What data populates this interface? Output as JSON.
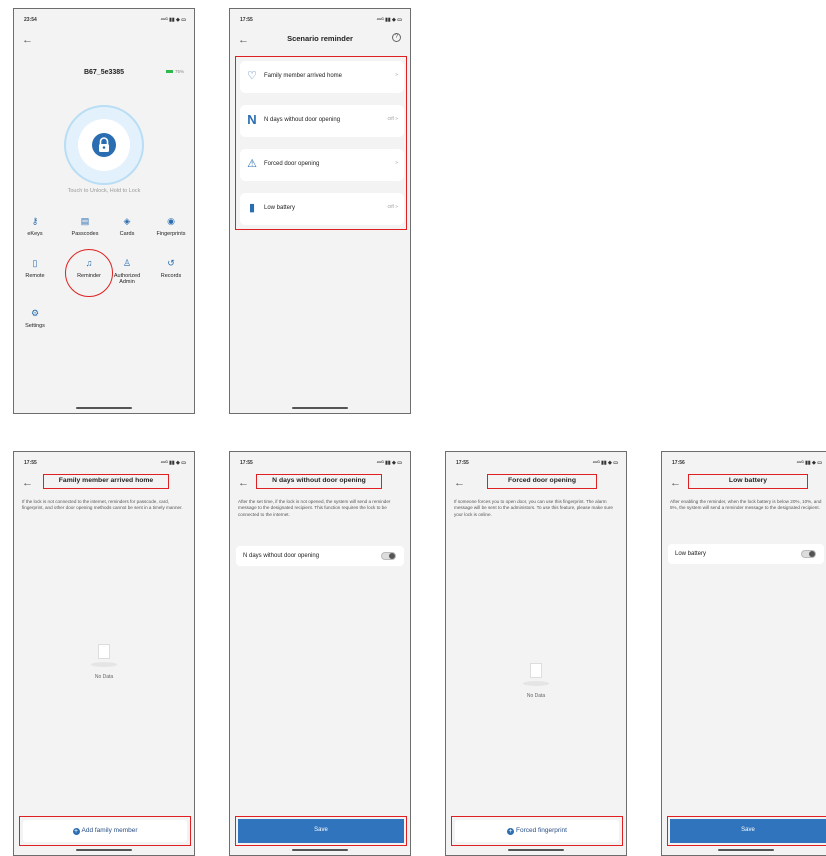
{
  "phone_lock": {
    "time": "23:54",
    "status_icons": "⁴⁶ᴳ ▮▮ ◆ ▭",
    "device_name": "B67_5e3385",
    "battery": "75%",
    "touch_hint": "Touch to Unlock, Hold to Lock",
    "menu": [
      {
        "label": "eKeys",
        "icon": "person-key-icon",
        "glyph": "⚷"
      },
      {
        "label": "Passcodes",
        "icon": "keypad-icon",
        "glyph": "▤"
      },
      {
        "label": "Cards",
        "icon": "card-icon",
        "glyph": "◈"
      },
      {
        "label": "Fingerprints",
        "icon": "fingerprint-icon",
        "glyph": "◉"
      },
      {
        "label": "Remote",
        "icon": "remote-icon",
        "glyph": "▯"
      },
      {
        "label": "Reminder",
        "icon": "bell-icon",
        "glyph": "♫"
      },
      {
        "label": "Authorized Admin",
        "icon": "admin-icon",
        "glyph": "♙"
      },
      {
        "label": "Records",
        "icon": "history-icon",
        "glyph": "↺"
      },
      {
        "label": "Settings",
        "icon": "gear-icon",
        "glyph": "⚙"
      }
    ],
    "colors": {
      "accent": "#2a6db0",
      "highlight": "#e02020"
    }
  },
  "phone_scenario": {
    "time": "17:55",
    "title": "Scenario reminder",
    "rows": [
      {
        "label": "Family member arrived home",
        "value": "",
        "icon": "heart-home-icon",
        "glyph": "♡"
      },
      {
        "label": "N days without door opening",
        "value": "Off",
        "icon": "n-letter-icon",
        "glyph": "N"
      },
      {
        "label": "Forced door opening",
        "value": "",
        "icon": "warning-icon",
        "glyph": "⚠"
      },
      {
        "label": "Low battery",
        "value": "Off",
        "icon": "battery-icon",
        "glyph": "▮"
      }
    ]
  },
  "phone_family": {
    "time": "17:55",
    "title": "Family member arrived home",
    "description": "If the lock is not connected to the internet, reminders for passcode, card, fingerprint, and other door opening methods cannot be sent in a timely manner.",
    "empty_text": "No Data",
    "button": "Add family member"
  },
  "phone_ndays": {
    "time": "17:55",
    "title": "N days without door opening",
    "description": "After the set time, if the lock is not opened, the system will send a reminder message to the designated recipient. This function requires the lock to be connected to the internet.",
    "toggle_label": "N days without door opening",
    "button": "Save"
  },
  "phone_forced": {
    "time": "17:55",
    "title": "Forced door opening",
    "description": "If someone forces you to open door, you can use this fingerprint. The alarm message will be sent to the administors. To use this feature, please make sure your lock is online.",
    "empty_text": "No Data",
    "button": "Forced fingerprint"
  },
  "phone_battery": {
    "time": "17:56",
    "title": "Low battery",
    "description": "After enabling the reminder, when the lock battery is below 20%, 10%, and 5%, the system will send a reminder message to the designated recipient.",
    "toggle_label": "Low battery",
    "button": "Save"
  }
}
